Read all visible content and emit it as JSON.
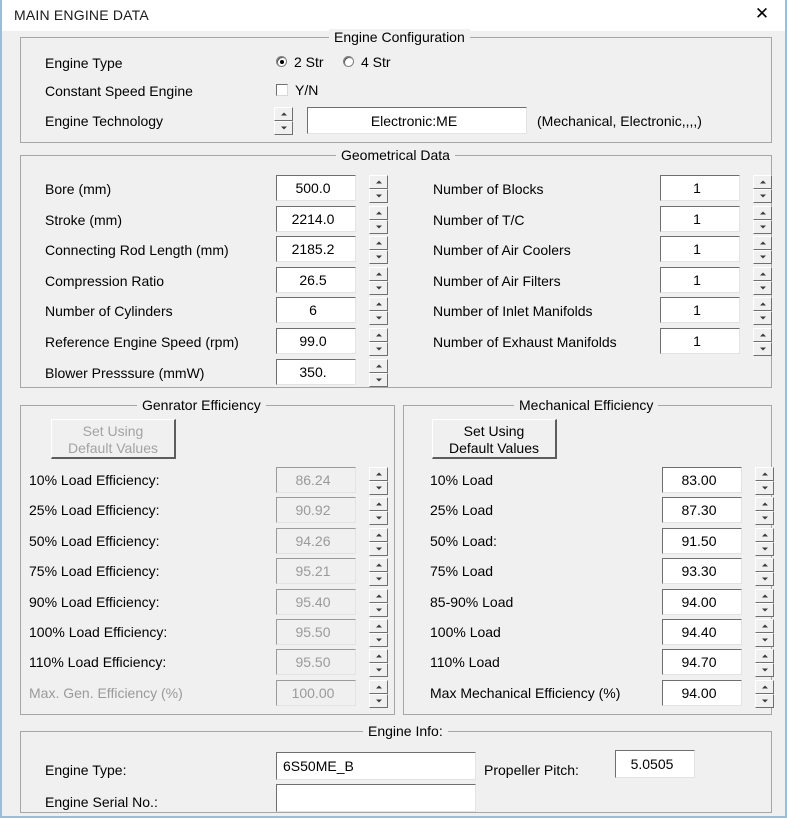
{
  "window": {
    "title": "MAIN ENGINE DATA",
    "close_icon": "close-icon",
    "close_glyph": "✕"
  },
  "engine_configuration": {
    "legend": "Engine Configuration",
    "engine_type_label": "Engine Type",
    "radio_2str": "2 Str",
    "radio_4str": "4 Str",
    "selected_stroke": "2 Str",
    "constant_speed_label": "Constant Speed Engine",
    "constant_speed_value": "Y/N",
    "constant_speed_checked": false,
    "engine_technology_label": "Engine Technology",
    "engine_technology_value": "Electronic:ME",
    "engine_technology_hint": "(Mechanical, Electronic,,,,)"
  },
  "geometrical_data": {
    "legend": "Geometrical Data",
    "left_rows": [
      {
        "label": "Bore (mm)",
        "value": "500.0"
      },
      {
        "label": "Stroke (mm)",
        "value": "2214.0"
      },
      {
        "label": "Connecting Rod Length (mm)",
        "value": "2185.2"
      },
      {
        "label": "Compression Ratio",
        "value": "26.5"
      },
      {
        "label": "Number of Cylinders",
        "value": "6"
      },
      {
        "label": "Reference Engine Speed (rpm)",
        "value": "99.0"
      },
      {
        "label": "Blower Presssure (mmW)",
        "value": "350."
      }
    ],
    "right_rows": [
      {
        "label": "Number of Blocks",
        "value": "1"
      },
      {
        "label": "Number of T/C",
        "value": "1"
      },
      {
        "label": "Number of Air Coolers",
        "value": "1"
      },
      {
        "label": "Number of Air Filters",
        "value": "1"
      },
      {
        "label": "Number of Inlet Manifolds",
        "value": "1"
      },
      {
        "label": "Number of Exhaust  Manifolds",
        "value": "1"
      }
    ]
  },
  "generator_efficiency": {
    "legend": "Genrator Efficiency",
    "button_line1": "Set Using",
    "button_line2": "Default Values",
    "button_disabled": true,
    "rows": [
      {
        "label": "10% Load Efficiency:",
        "value": "86.24",
        "dim_label": false
      },
      {
        "label": "25% Load Efficiency:",
        "value": "90.92",
        "dim_label": false
      },
      {
        "label": "50% Load Efficiency:",
        "value": "94.26",
        "dim_label": false
      },
      {
        "label": "75% Load Efficiency:",
        "value": "95.21",
        "dim_label": false
      },
      {
        "label": "90% Load Efficiency:",
        "value": "95.40",
        "dim_label": false
      },
      {
        "label": "100% Load Efficiency:",
        "value": "95.50",
        "dim_label": false
      },
      {
        "label": "110% Load Efficiency:",
        "value": "95.50",
        "dim_label": false
      },
      {
        "label": "Max. Gen. Efficiency (%)",
        "value": "100.00",
        "dim_label": true
      }
    ]
  },
  "mechanical_efficiency": {
    "legend": "Mechanical Efficiency",
    "button_line1": "Set Using",
    "button_line2": "Default Values",
    "button_disabled": false,
    "rows": [
      {
        "label": "10% Load",
        "value": "83.00"
      },
      {
        "label": "25% Load",
        "value": "87.30"
      },
      {
        "label": "50% Load:",
        "value": "91.50"
      },
      {
        "label": "75% Load",
        "value": "93.30"
      },
      {
        "label": "85-90% Load",
        "value": "94.00"
      },
      {
        "label": "100% Load",
        "value": "94.40"
      },
      {
        "label": "110% Load",
        "value": "94.70"
      },
      {
        "label": "Max Mechanical Efficiency (%)",
        "value": "94.00"
      }
    ]
  },
  "engine_info": {
    "legend": "Engine Info:",
    "engine_type_label": "Engine Type:",
    "engine_type_value": "6S50ME_B",
    "engine_serial_label": "Engine Serial No.:",
    "engine_serial_value": "",
    "propeller_pitch_label": "Propeller Pitch:",
    "propeller_pitch_value": "5.0505"
  },
  "colors": {
    "dialog_face": "#f0f0f0",
    "frame_border": "#9bbdd6",
    "group_border": "#a6a6a6",
    "disabled_text": "#9a9a9a",
    "field_bg": "#ffffff"
  }
}
